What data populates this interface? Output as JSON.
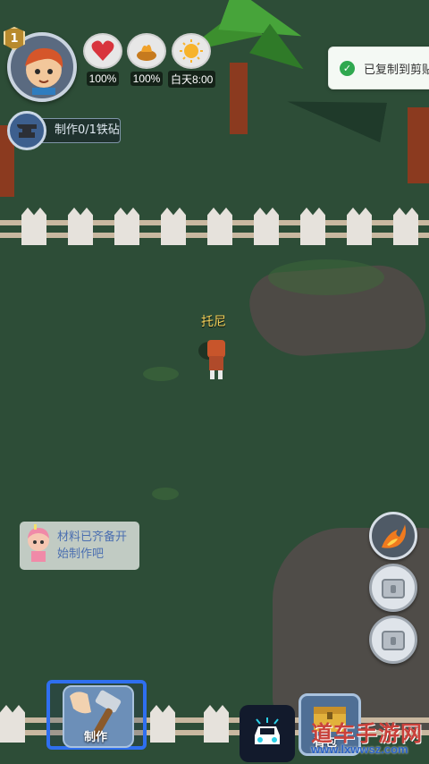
{
  "player": {
    "level": "1",
    "avatar_icon": "player-portrait"
  },
  "stats": [
    {
      "name": "health",
      "icon": "heart-icon",
      "value": "100%"
    },
    {
      "name": "hunger",
      "icon": "food-icon",
      "value": "100%"
    },
    {
      "name": "time",
      "icon": "sun-icon",
      "value": "白天8:00"
    }
  ],
  "quest": {
    "icon": "anvil-icon",
    "label": "制作0/1铁砧"
  },
  "toast": {
    "text": "已复制到剪贴"
  },
  "npc": {
    "name": "托尼"
  },
  "tip": {
    "text": "材料已齐备开始制作吧"
  },
  "skills": [
    {
      "icon": "fireball-icon",
      "locked": false
    },
    {
      "icon": "lock-icon",
      "locked": true
    },
    {
      "icon": "lock-icon",
      "locked": true
    }
  ],
  "bottom": {
    "craft_label": "制作",
    "bag_label": "背包"
  },
  "watermark": {
    "title": "道车手游网",
    "url": "www.lxwwsz.com"
  },
  "colors": {
    "ground": "#2d4d37",
    "highlight": "#2f6ff0",
    "npc_name": "#f5d25a",
    "tip_text": "#4b6fb0"
  }
}
